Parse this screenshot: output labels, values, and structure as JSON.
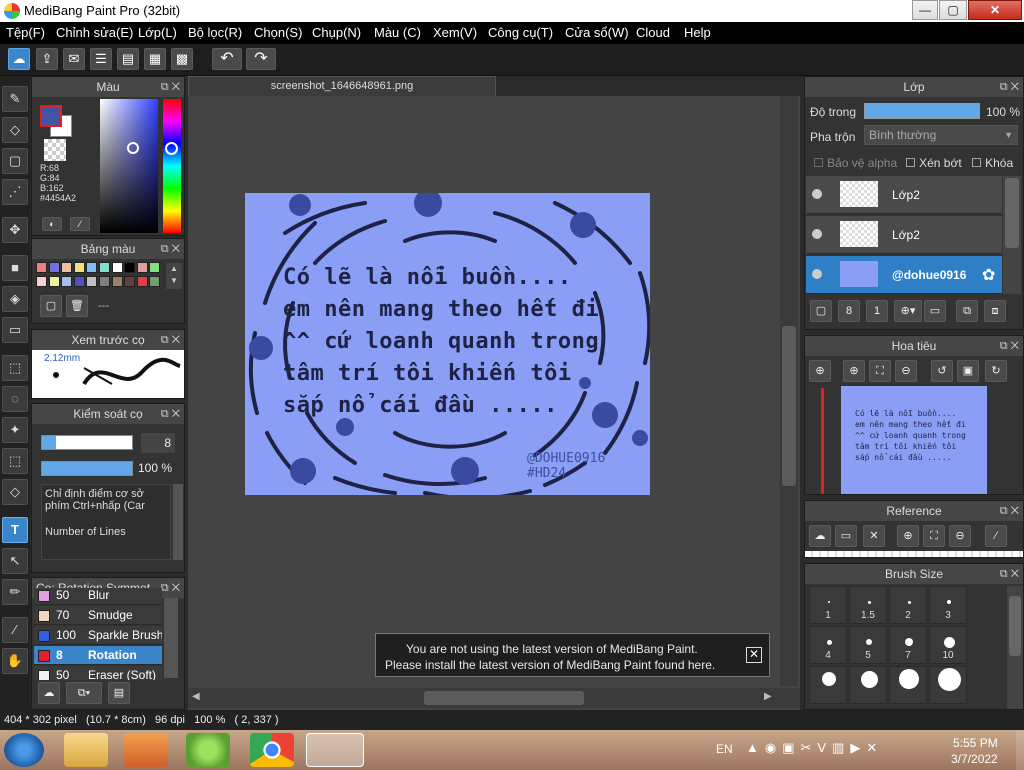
{
  "window": {
    "title": "MediBang Paint Pro (32bit)",
    "min": "—",
    "max": "▢",
    "close": "✕"
  },
  "menu": [
    "Tệp(F)",
    "Chỉnh sửa(E)",
    "Lớp(L)",
    "Bộ lọc(R)",
    "Chọn(S)",
    "Chụp(N)",
    "Màu (C)",
    "Xem(V)",
    "Công cụ(T)",
    "Cửa sổ(W)",
    "Cloud",
    "Help"
  ],
  "toolbar": {
    "undo": "↶",
    "redo": "↷"
  },
  "color_panel": {
    "title": "Màu",
    "r": "R:68",
    "g": "G:84",
    "b": "B:162",
    "hex": "#4454A2",
    "fg_color": "#4454A2",
    "bg_color": "#ffffff"
  },
  "palette_panel": {
    "title": "Bảng màu",
    "swatches": [
      "#f08080",
      "#7070e0",
      "#f0c0a0",
      "#f0e080",
      "#80c0f0",
      "#80e0d0",
      "#ffffff",
      "#000000",
      "#e0a0a0",
      "#80e080",
      "#f8d0d0",
      "#f0f0a0",
      "#a0c0f0",
      "#5050c0",
      "#c0c0c0",
      "#808080",
      "#a08060",
      "#604040",
      "#e04040",
      "#70a070"
    ],
    "none_label": "---"
  },
  "brush_preview": {
    "title": "Xem trước cọ",
    "size": "2.12mm"
  },
  "brush_control": {
    "title": "Kiểm soát cọ",
    "size_value": "8",
    "opacity_value": "100 %",
    "hint_1": "Chỉ định điểm cơ sở",
    "hint_2": "phím Ctrl+nhấp (Car",
    "lines_label": "Number of Lines"
  },
  "brush_list": {
    "title": "Cọ: Rotation Symmet...",
    "items": [
      {
        "size": "50",
        "name": "Blur",
        "color": "#e0a0e0"
      },
      {
        "size": "70",
        "name": "Smudge",
        "color": "#f4d6c0"
      },
      {
        "size": "100",
        "name": "Sparkle Brush",
        "color": "#3060e0"
      },
      {
        "size": "8",
        "name": "Rotation",
        "color": "#e02030",
        "selected": true
      },
      {
        "size": "50",
        "name": "Eraser (Soft)",
        "color": "#f0f0f0"
      }
    ]
  },
  "document": {
    "tab": "screenshot_1646648961.png",
    "lines": [
      "Có lẽ là nỗi buồn....",
      "em nên mang theo hết đi",
      "^^ cứ loanh quanh trong",
      "tâm trí tôi khiến tôi",
      "sắp nổ cái đầu ....."
    ],
    "signature_1": "@DOHUE0916",
    "signature_2": "#HD24",
    "bg_color": "#8b9ef6"
  },
  "notice": {
    "line1": "You are not using the latest version of MediBang Paint.",
    "line2": "Please install the latest version of MediBang Paint found here.",
    "close": "✕"
  },
  "layer_panel": {
    "title": "Lớp",
    "opacity_label": "Độ trong",
    "opacity_value": "100 %",
    "opacity_fraction": 1.0,
    "blend_label": "Pha trộn",
    "blend_value": "Bình thường",
    "protect_alpha": "Bảo vệ alpha",
    "clip": "Xén bớt",
    "lock": "Khóa",
    "layers": [
      {
        "name": "Lớp2",
        "selected": false
      },
      {
        "name": "Lớp2",
        "selected": false
      },
      {
        "name": "@dohue0916",
        "selected": true
      }
    ]
  },
  "navigator": {
    "title": "Hoa tiêu",
    "mini_lines": [
      "Có lẽ là nỗi buồn....",
      "em nên mang theo hết đi",
      "^^ cứ loanh quanh trong",
      "tâm trí tôi khiến tôi",
      "sắp nổ cái đầu ....."
    ]
  },
  "reference": {
    "title": "Reference"
  },
  "brush_size": {
    "title": "Brush Size",
    "sizes": [
      "1",
      "1.5",
      "2",
      "3",
      "4",
      "5",
      "7",
      "10"
    ]
  },
  "status": {
    "text": "404 * 302 pixel   (10.7 * 8cm)   96 dpi   100 %   ( 2, 337 )"
  },
  "taskbar": {
    "lang": "EN",
    "time": "5:55 PM",
    "date": "3/7/2022"
  }
}
